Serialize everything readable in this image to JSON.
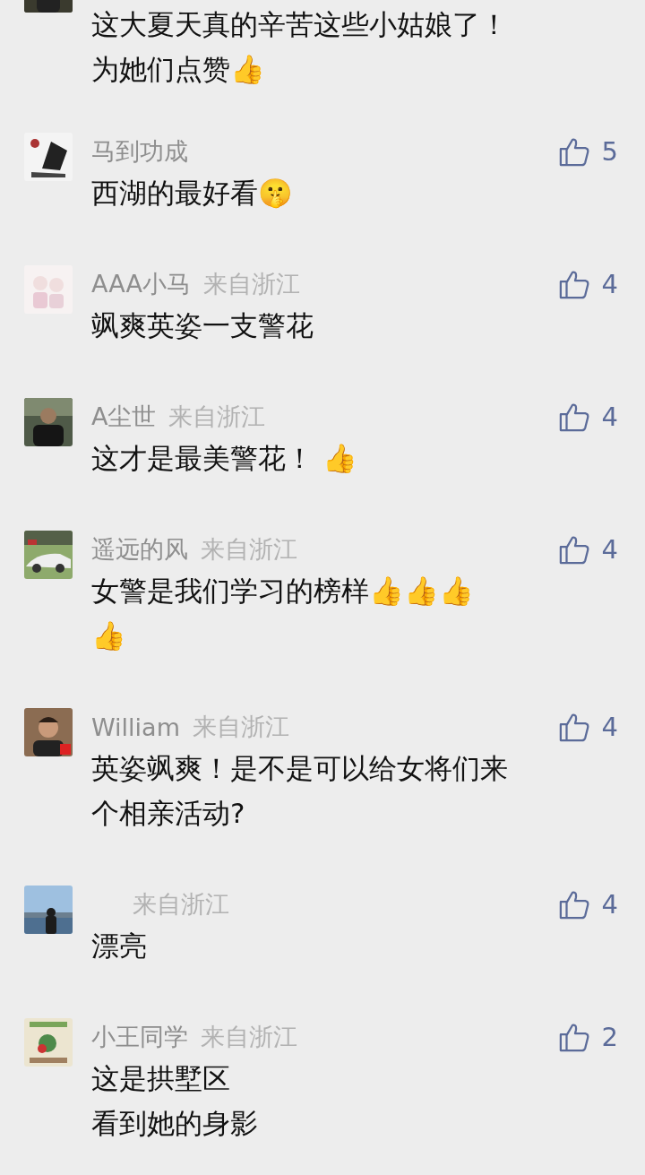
{
  "comments": [
    {
      "avatar": {
        "kind": "picture"
      },
      "lines": [
        "这大夏天真的辛苦这些小姑娘了！",
        "为她们点赞👍"
      ]
    },
    {
      "avatar": {
        "kind": "picture"
      },
      "name": "马到功成",
      "likes": "5",
      "lines": [
        "西湖的最好看🤫"
      ]
    },
    {
      "avatar": {
        "kind": "picture"
      },
      "name": "AAA小马",
      "location": "来自浙江",
      "likes": "4",
      "lines": [
        "飒爽英姿一支警花"
      ]
    },
    {
      "avatar": {
        "kind": "picture"
      },
      "name": "A尘世",
      "location": "来自浙江",
      "likes": "4",
      "lines": [
        "这才是最美警花！ 👍"
      ]
    },
    {
      "avatar": {
        "kind": "picture"
      },
      "name": "遥远的风",
      "location": "来自浙江",
      "likes": "4",
      "lines": [
        "女警是我们学习的榜样👍👍👍",
        "👍"
      ]
    },
    {
      "avatar": {
        "kind": "picture"
      },
      "name": "William",
      "location": "来自浙江",
      "likes": "4",
      "lines": [
        "英姿飒爽！是不是可以给女将们来",
        "个相亲活动?"
      ]
    },
    {
      "avatar": {
        "kind": "picture"
      },
      "location": "来自浙江",
      "likes": "4",
      "lines": [
        "漂亮"
      ]
    },
    {
      "avatar": {
        "kind": "picture"
      },
      "name": "小王同学",
      "location": "来自浙江",
      "likes": "2",
      "lines": [
        "这是拱墅区",
        "看到她的身影"
      ]
    }
  ]
}
